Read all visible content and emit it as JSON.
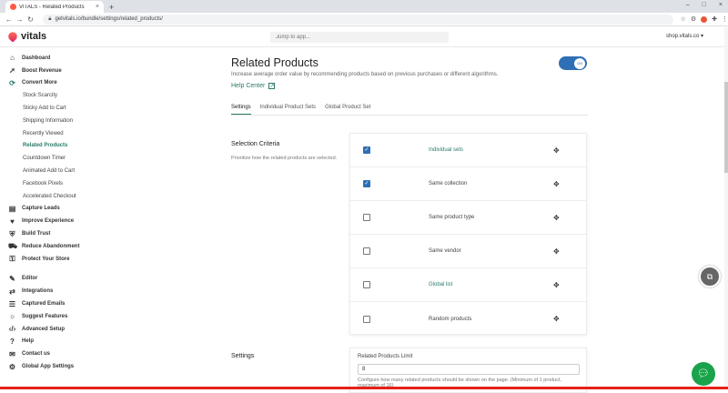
{
  "browser": {
    "tab_title": "VITALS - Related Products",
    "tab_close": "×",
    "new_tab": "+",
    "url": "getvitals.io/bundle/settings/related_products/",
    "window_controls": [
      "–",
      "□",
      "×"
    ]
  },
  "app": {
    "logo_text": "vitals",
    "search_placeholder": "Jump to app...",
    "shop_name": "shop.vitals.co ▾"
  },
  "sidebar": {
    "items": [
      {
        "label": "Dashboard",
        "icon": "home-icon",
        "bold": true
      },
      {
        "label": "Boost Revenue",
        "icon": "rocket-icon",
        "bold": true
      },
      {
        "label": "Convert More",
        "icon": "cycle-icon",
        "bold": true
      },
      {
        "label": "Stock Scarcity",
        "sub": true
      },
      {
        "label": "Sticky Add to Cart",
        "sub": true
      },
      {
        "label": "Shipping Information",
        "sub": true
      },
      {
        "label": "Recently Viewed",
        "sub": true
      },
      {
        "label": "Related Products",
        "sub": true,
        "active": true
      },
      {
        "label": "Countdown Timer",
        "sub": true
      },
      {
        "label": "Animated Add to Cart",
        "sub": true
      },
      {
        "label": "Facebook Pixels",
        "sub": true
      },
      {
        "label": "Accelerated Checkout",
        "sub": true
      },
      {
        "label": "Capture Leads",
        "icon": "clipboard-icon",
        "bold": true
      },
      {
        "label": "Improve Experience",
        "icon": "heart-icon",
        "bold": true
      },
      {
        "label": "Build Trust",
        "icon": "shield-icon",
        "bold": true
      },
      {
        "label": "Reduce Abandonment",
        "icon": "cart-icon",
        "bold": true
      },
      {
        "label": "Protect Your Store",
        "icon": "lock-icon",
        "bold": true
      }
    ],
    "bottom_items": [
      {
        "label": "Editor",
        "icon": "edit-icon"
      },
      {
        "label": "Integrations",
        "icon": "integrations-icon"
      },
      {
        "label": "Captured Emails",
        "icon": "list-icon"
      },
      {
        "label": "Suggest Features",
        "icon": "bulb-icon"
      },
      {
        "label": "Advanced Setup",
        "icon": "code-icon"
      },
      {
        "label": "Help",
        "icon": "help-icon"
      },
      {
        "label": "Contact us",
        "icon": "mail-icon"
      },
      {
        "label": "Global App Settings",
        "icon": "gear-icon"
      }
    ]
  },
  "page": {
    "title": "Related Products",
    "description": "Increase average order value by recommending products based on previous purchases or different algorithms.",
    "help_label": "Help Center",
    "toggle_label": "ON",
    "tabs": [
      "Settings",
      "Individual Product Sets",
      "Global Product Set"
    ],
    "selection": {
      "heading": "Selection Criteria",
      "description": "Prioritize how the related products are selected.",
      "rows": [
        {
          "label": "Individual sets",
          "checked": true,
          "link": true
        },
        {
          "label": "Same collection",
          "checked": true,
          "link": false
        },
        {
          "label": "Same product type",
          "checked": false,
          "link": false
        },
        {
          "label": "Same vendor",
          "checked": false,
          "link": false
        },
        {
          "label": "Global list",
          "checked": false,
          "link": true
        },
        {
          "label": "Random products",
          "checked": false,
          "link": false
        }
      ]
    },
    "settings": {
      "heading": "Settings",
      "limit_label": "Related Products Limit",
      "limit_value": "8",
      "limit_hint": "Configure how many related products should be shown on the page. (Minimum of 1 product, maximum of 16)"
    }
  }
}
